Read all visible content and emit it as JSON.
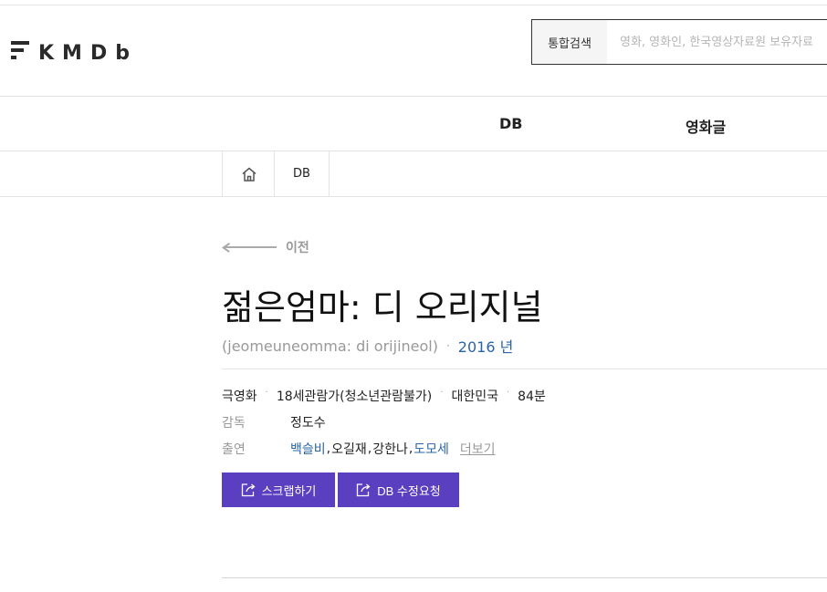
{
  "header": {
    "logo_text": "KMDb",
    "search": {
      "label": "통합검색",
      "placeholder": "영화, 영화인, 한국영상자료원 보유자료"
    }
  },
  "gnb": {
    "items": [
      {
        "label": "DB"
      },
      {
        "label": "영화글"
      }
    ]
  },
  "breadcrumb": {
    "home_icon": "home-icon",
    "current": "DB"
  },
  "movie": {
    "back_label": "이전",
    "title": "젊은엄마: 디 오리지널",
    "romanized": "(jeomeuneomma: di orijineol)",
    "year": "2016 년",
    "meta": [
      "극영화",
      "18세관람가(청소년관람불가)",
      "대한민국",
      "84분"
    ],
    "director_label": "감독",
    "director": "정도수",
    "cast_label": "출연",
    "cast": [
      {
        "name": "백슬비",
        "linked": true
      },
      {
        "name": "오길재",
        "linked": false
      },
      {
        "name": "강한나",
        "linked": false
      },
      {
        "name": "도모세",
        "linked": true
      }
    ],
    "more_label": "더보기"
  },
  "actions": {
    "scrap_label": "스크랩하기",
    "edit_label": "DB 수정요청",
    "accent_color": "#5a3fc0"
  }
}
